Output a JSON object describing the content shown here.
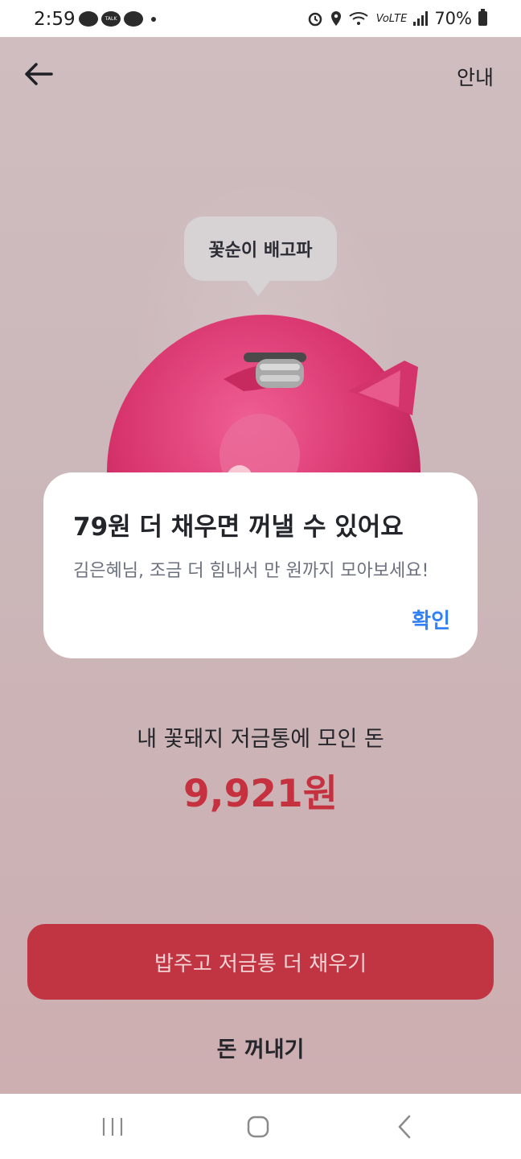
{
  "status_bar": {
    "time": "2:59",
    "talk_icon_text": "TALK",
    "network": "VoLTE",
    "battery": "70%"
  },
  "header": {
    "info_label": "안내"
  },
  "piggy": {
    "speech": "꽃순이 배고파"
  },
  "dialog": {
    "title": "79원 더 채우면 꺼낼 수 있어요",
    "message": "김은혜님, 조금 더 힘내서 만 원까지 모아보세요!",
    "confirm": "확인"
  },
  "summary": {
    "label": "내 꽃돼지 저금통에 모인 돈",
    "amount": "9,921원"
  },
  "actions": {
    "primary": "밥주고 저금통 더 채우기",
    "secondary": "돈 꺼내기"
  },
  "colors": {
    "accent_red": "#c13441",
    "amount_red": "#c6313f",
    "confirm_blue": "#3182f6",
    "background": "#cbb7b9"
  }
}
